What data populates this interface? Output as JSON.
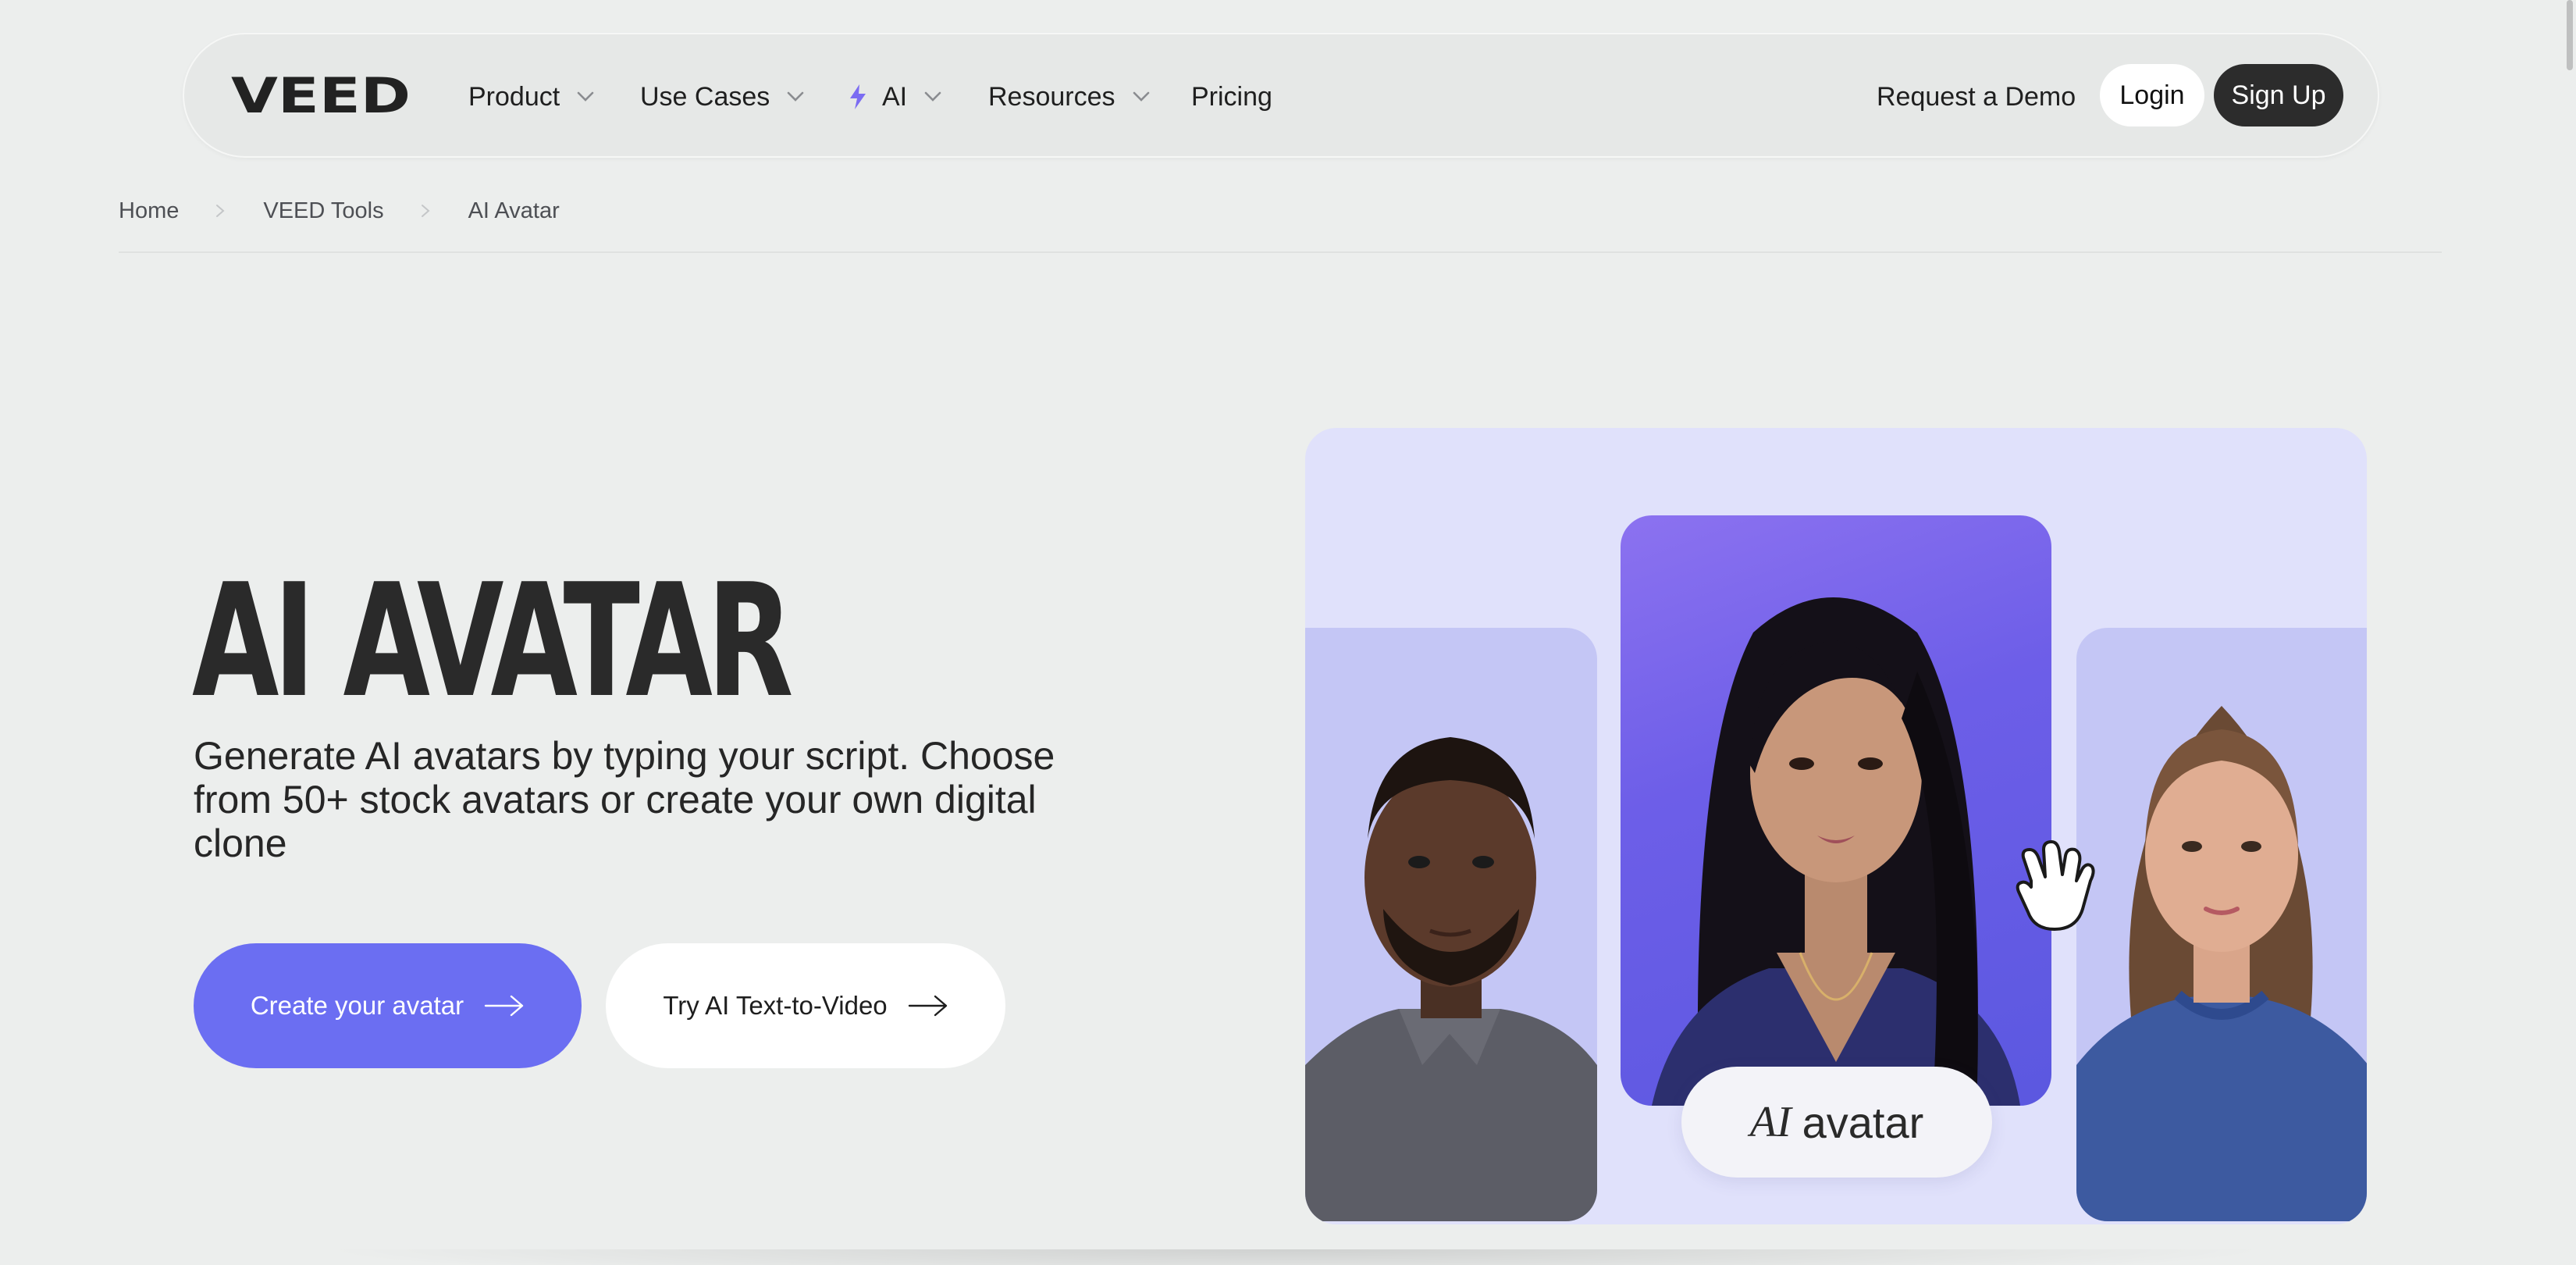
{
  "brand": {
    "logo_text": "VEED",
    "accent_color": "#6b6ef2",
    "ai_bolt_color": "#7b6cf2"
  },
  "nav": {
    "items": [
      {
        "label": "Product",
        "has_dropdown": true
      },
      {
        "label": "Use Cases",
        "has_dropdown": true
      },
      {
        "label": "AI",
        "has_dropdown": true,
        "icon": "bolt-icon"
      },
      {
        "label": "Resources",
        "has_dropdown": true
      },
      {
        "label": "Pricing",
        "has_dropdown": false
      }
    ],
    "request_demo": "Request a Demo",
    "login": "Login",
    "signup": "Sign Up"
  },
  "breadcrumb": [
    "Home",
    "VEED Tools",
    "AI Avatar"
  ],
  "hero": {
    "title": "AI AVATAR",
    "subtitle": "Generate AI avatars by typing your script. Choose from 50+ stock avatars or create your own digital clone",
    "primary_cta": "Create your avatar",
    "secondary_cta": "Try AI Text-to-Video"
  },
  "showcase": {
    "label_italic": "AI",
    "label_rest": "avatar"
  }
}
